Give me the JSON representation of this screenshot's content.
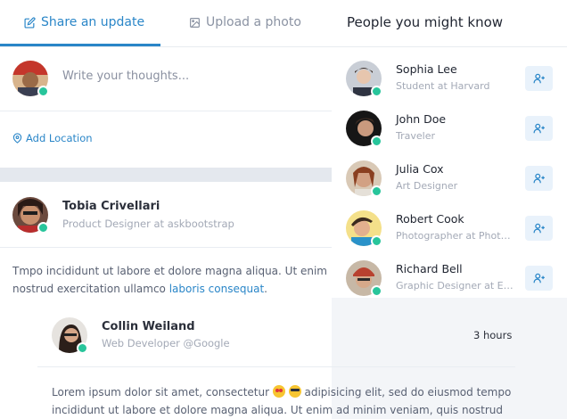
{
  "tabs": {
    "share": "Share an update",
    "upload": "Upload a photo"
  },
  "composer": {
    "placeholder": "Write your thoughts...",
    "add_location": "Add Location"
  },
  "post": {
    "author": "Tobia Crivellari",
    "role": "Product Designer at askbootstrap",
    "text_line1": "Tmpo incididunt ut labore et dolore magna aliqua. Ut enim ad",
    "text_line2_prefix": "nostrud exercitation ullamco ",
    "text_link": "laboris consequat",
    "text_line2_suffix": "."
  },
  "comment": {
    "author": "Collin Weiland",
    "role": "Web Developer @Google",
    "time": "3 hours",
    "text_part1": "Lorem ipsum dolor sit amet, consectetur ",
    "text_part2": " adipisicing elit, sed do eiusmod tempo",
    "text_line2": "incididunt ut labore et dolore magna aliqua. Ut enim ad minim veniam, quis nostrud"
  },
  "people_panel": {
    "title": "People you might know",
    "people": [
      {
        "name": "Sophia Lee",
        "subtitle": "Student at Harvard"
      },
      {
        "name": "John Doe",
        "subtitle": "Traveler"
      },
      {
        "name": "Julia Cox",
        "subtitle": "Art Designer"
      },
      {
        "name": "Robert Cook",
        "subtitle": "Photographer at Photography"
      },
      {
        "name": "Richard Bell",
        "subtitle": "Graphic Designer at Envato"
      }
    ]
  },
  "colors": {
    "accent": "#2a86c8",
    "online": "#28c59b"
  },
  "icons": {
    "share": "edit-icon",
    "upload": "image-icon",
    "location": "map-pin-icon",
    "add": "user-plus-icon"
  }
}
